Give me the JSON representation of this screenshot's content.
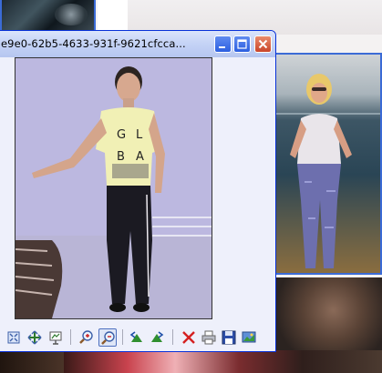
{
  "window": {
    "title": "e9e0-62b5-4633-931f-9621cfcca..."
  },
  "photo": {
    "shirt_text": "G L B A"
  },
  "toolbar": {
    "items": [
      "fit-window",
      "actual-size",
      "slideshow",
      "zoom-in",
      "zoom-out",
      "rotate-left",
      "rotate-right",
      "delete",
      "print",
      "save",
      "set-as-desktop"
    ]
  },
  "colors": {
    "window_border": "#0831d9",
    "title_bar": "#c6d4f6",
    "close_button": "#c9452a",
    "tile_border": "#3b6bd6"
  }
}
